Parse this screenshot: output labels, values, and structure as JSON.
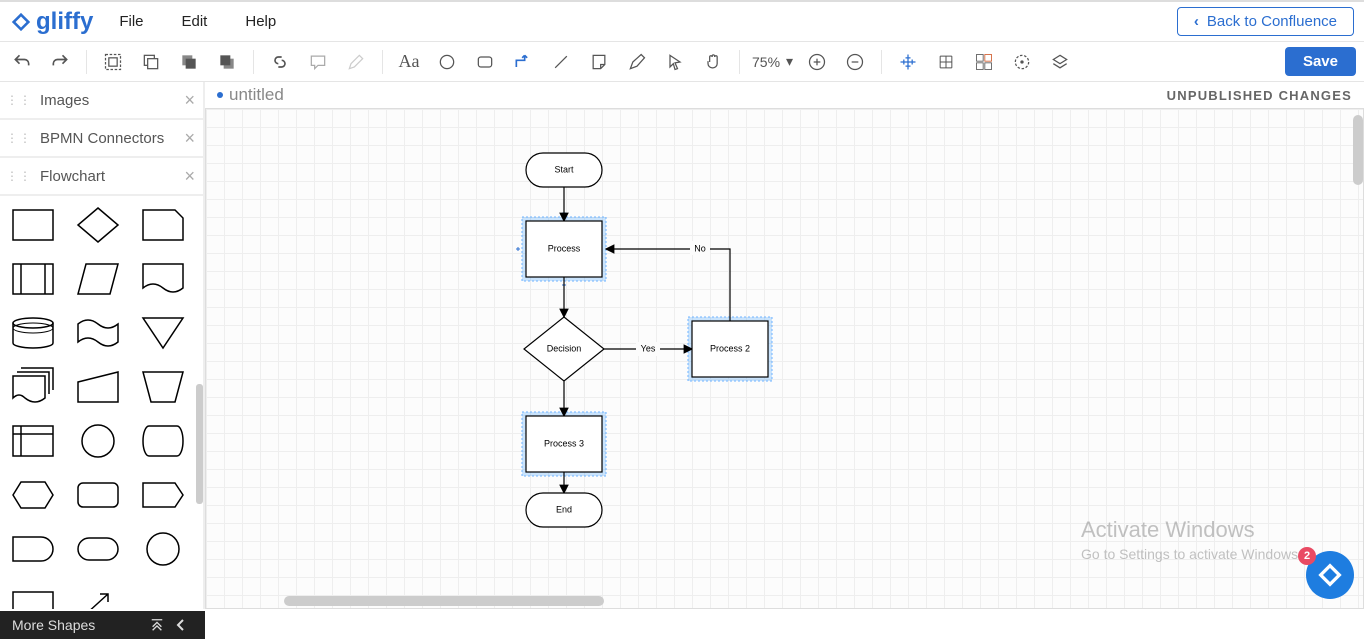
{
  "app_name": "gliffy",
  "menu": {
    "file": "File",
    "edit": "Edit",
    "help": "Help"
  },
  "back_button": "Back to Confluence",
  "toolbar": {
    "zoom_level": "75%",
    "save_label": "Save"
  },
  "document": {
    "title": "untitled",
    "status": "UNPUBLISHED CHANGES"
  },
  "sidebar": {
    "categories": [
      {
        "label": "Images"
      },
      {
        "label": "BPMN Connectors"
      },
      {
        "label": "Flowchart"
      }
    ],
    "more_shapes": "More Shapes"
  },
  "flowchart": {
    "nodes": {
      "start": "Start",
      "process": "Process",
      "decision": "Decision",
      "process2": "Process 2",
      "process3": "Process 3",
      "end": "End"
    },
    "edges": {
      "yes": "Yes",
      "no": "No"
    }
  },
  "assistant_badge": "2",
  "watermark": {
    "l1": "Activate Windows",
    "l2": "Go to Settings to activate Windows."
  }
}
